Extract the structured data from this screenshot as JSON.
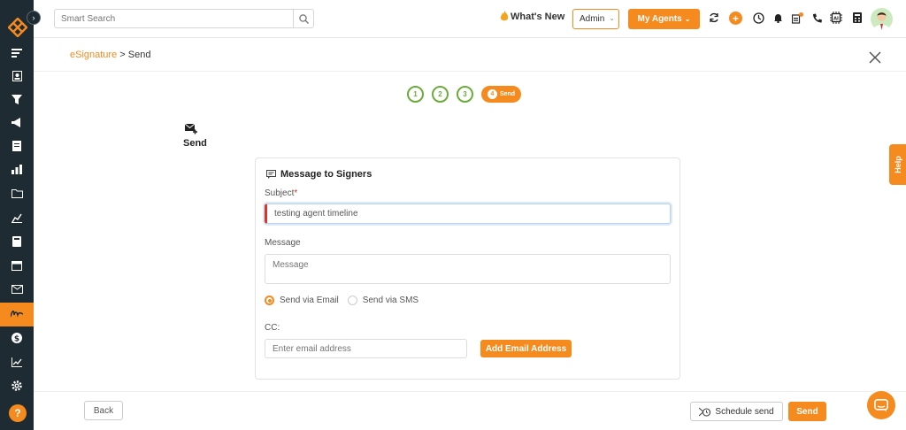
{
  "search": {
    "placeholder": "Smart Search"
  },
  "topbar": {
    "whats_new": "What's New",
    "admin_label": "Admin",
    "agents_label": "My Agents"
  },
  "breadcrumb": {
    "parent": "eSignature",
    "separator": ">",
    "current": "Send"
  },
  "steps": {
    "items": [
      "1",
      "2",
      "3"
    ],
    "active_number": "4",
    "active_label": "Send"
  },
  "section": {
    "title": "Send"
  },
  "card": {
    "title": "Message to Signers",
    "subject_label": "Subject",
    "required_mark": "*",
    "subject_value": "testing agent timeline",
    "message_label": "Message",
    "message_placeholder": "Message",
    "radio_email": "Send via Email",
    "radio_sms": "Send via SMS",
    "cc_label": "CC:",
    "cc_placeholder": "Enter email address",
    "add_email_label": "Add Email Address"
  },
  "footer": {
    "back_label": "Back",
    "schedule_label": "Schedule send",
    "send_label": "Send"
  },
  "help_tab": {
    "label": "Help"
  },
  "colors": {
    "accent": "#f58a1f",
    "sidebar": "#1f2b33",
    "step_done": "#6aab3a",
    "required": "#d9352b"
  }
}
